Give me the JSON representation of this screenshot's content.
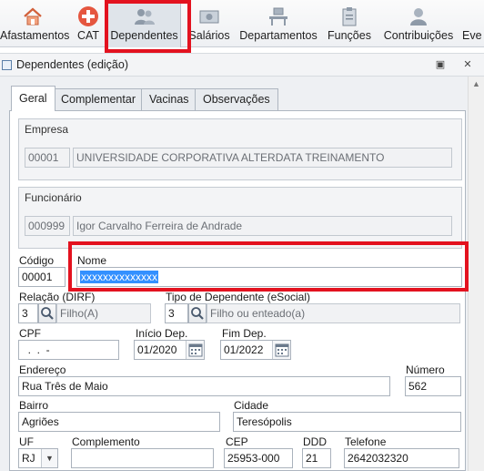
{
  "toolbar": {
    "items": [
      {
        "label": "Afastamentos"
      },
      {
        "label": "CAT"
      },
      {
        "label": "Dependentes"
      },
      {
        "label": "Salários"
      },
      {
        "label": "Departamentos"
      },
      {
        "label": "Funções"
      },
      {
        "label": "Contribuições"
      },
      {
        "label": "Eve"
      }
    ]
  },
  "window": {
    "title": "Dependentes (edição)",
    "restore_glyph": "▣",
    "close_glyph": "✕"
  },
  "tabs": [
    {
      "label": "Geral"
    },
    {
      "label": "Complementar"
    },
    {
      "label": "Vacinas"
    },
    {
      "label": "Observações"
    }
  ],
  "empresa": {
    "title": "Empresa",
    "code": "00001",
    "name": "UNIVERSIDADE CORPORATIVA ALTERDATA TREINAMENTO"
  },
  "funcionario": {
    "title": "Funcionário",
    "code": "000999",
    "name": "Igor Carvalho Ferreira de Andrade"
  },
  "form": {
    "codigo_label": "Código",
    "codigo_value": "00001",
    "nome_label": "Nome",
    "nome_value": "xxxxxxxxxxxxxx",
    "relacao_label": "Relação (DIRF)",
    "relacao_code": "3",
    "relacao_desc": "Filho(A)",
    "tipo_label": "Tipo de Dependente (eSocial)",
    "tipo_code": "3",
    "tipo_desc": "Filho ou enteado(a)",
    "cpf_label": "CPF",
    "cpf_value": "  .  .  -",
    "inicio_label": "Início Dep.",
    "inicio_value": "01/2020",
    "fim_label": "Fim Dep.",
    "fim_value": "01/2022",
    "endereco_label": "Endereço",
    "endereco_value": "Rua Três de Maio",
    "numero_label": "Número",
    "numero_value": "562",
    "bairro_label": "Bairro",
    "bairro_value": "Agriões",
    "cidade_label": "Cidade",
    "cidade_value": "Teresópolis",
    "uf_label": "UF",
    "uf_value": "RJ",
    "complemento_label": "Complemento",
    "complemento_value": "",
    "cep_label": "CEP",
    "cep_value": "25953-000",
    "ddd_label": "DDD",
    "ddd_value": "21",
    "telefone_label": "Telefone",
    "telefone_value": "2642032320"
  },
  "colors": {
    "highlight_border": "#e3121f",
    "selection": "#3390ff"
  }
}
